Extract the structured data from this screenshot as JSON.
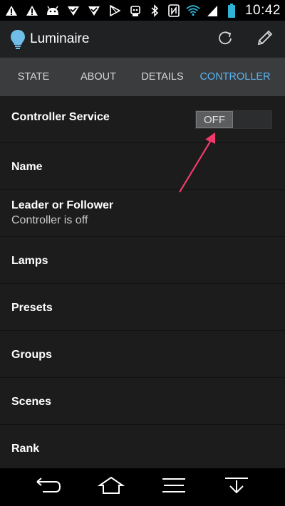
{
  "status_bar": {
    "time": "10:42",
    "left_icons": [
      "warning-icon",
      "warning-icon",
      "android-icon",
      "check-triangle-icon",
      "check-triangle-icon",
      "play-store-icon"
    ],
    "right_icons": [
      "robot-icon",
      "bluetooth-icon",
      "nfc-icon",
      "wifi-icon",
      "signal-icon",
      "battery-icon"
    ]
  },
  "action_bar": {
    "title": "Luminaire",
    "icons": [
      "lightbulb-icon",
      "refresh-icon",
      "edit-pencil-icon"
    ]
  },
  "tabs": [
    {
      "label": "STATE",
      "active": false
    },
    {
      "label": "ABOUT",
      "active": false
    },
    {
      "label": "DETAILS",
      "active": false
    },
    {
      "label": "CONTROLLER",
      "active": true
    }
  ],
  "controller_service": {
    "label": "Controller Service",
    "toggle_label": "OFF"
  },
  "rows": [
    {
      "title": "Name"
    },
    {
      "title": "Leader or Follower",
      "subtitle": "Controller is off"
    },
    {
      "title": "Lamps"
    },
    {
      "title": "Presets"
    },
    {
      "title": "Groups"
    },
    {
      "title": "Scenes"
    },
    {
      "title": "Rank"
    }
  ],
  "nav_bar": {
    "icons": [
      "back-icon",
      "home-icon",
      "menu-icon",
      "collapse-icon"
    ]
  },
  "colors": {
    "accent": "#5ab4f2",
    "annotation_arrow": "#f03a6a",
    "background": "#1c1c1d"
  }
}
